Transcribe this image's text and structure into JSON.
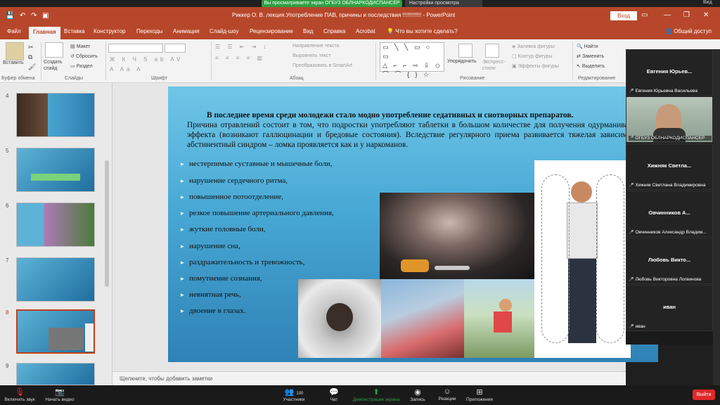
{
  "zoom_top": {
    "banner": "Вы просматриваете экран ОГБУЗ ОБЛНАРКОДИСПАНСЕР",
    "view_options": "Настройки просмотра",
    "view_label": "Вид"
  },
  "ppt": {
    "title": "Риккер О. В. лекция.Употребление ПАВ, причины и последствия  !!!!!!!!!!!!  -  PowerPoint",
    "login": "Вход",
    "tabs": [
      "Файл",
      "Главная",
      "Вставка",
      "Конструктор",
      "Переходы",
      "Анимация",
      "Слайд-шоу",
      "Рецензирование",
      "Вид",
      "Справка",
      "Acrobat",
      "Что вы хотите сделать?"
    ],
    "share": "Общий доступ",
    "ribbon": {
      "paste": "Вставить",
      "clipboard": "Буфер обмена",
      "create_slide": "Создать слайд",
      "layout": "Макет",
      "reset": "Сбросить",
      "section": "Раздел",
      "slides": "Слайды",
      "font": "Шрифт",
      "text_dir": "Направление текста",
      "align_text": "Выровнять текст",
      "smartart": "Преобразовать в SmartArt",
      "paragraph": "Абзац",
      "arrange": "Упорядочить",
      "express": "Экспресс-стили",
      "fill": "Заливка фигуры",
      "outline": "Контур фигуры",
      "effects": "Эффекты фигуры",
      "drawing": "Рисование",
      "find": "Найти",
      "replace": "Заменить",
      "select": "Выделить",
      "editing": "Редактирование"
    },
    "thumb_numbers": [
      "4",
      "5",
      "6",
      "7",
      "8",
      "9"
    ],
    "notes_placeholder": "Щелкните, чтобы добавить заметки"
  },
  "slide": {
    "heading": "В последнее время среди молодежи стало модно употребление седативных и снотворных препаратов.",
    "body": "Причина отравлений состоит в том, что подростки употребляют таблетки в большом количестве для получения одурманивающего эффекта (возникают галлюцинации и бредовые состояния). Вследствие регулярного приема развивается тяжелая зависимость и абстинентный синдром – ломка проявляется как и у наркоманов.",
    "bullets": [
      "нестерпимые суставные и мышечные боли,",
      "нарушение сердечного ритма,",
      "повышенное потоотделение,",
      "резкое повышение артериального давления,",
      "жуткие головные боли,",
      "нарушение сна,",
      "раздражительность и тревожность,",
      "помутнение сознания,",
      "невнятная речь,",
      "двоение в глазах."
    ]
  },
  "participants": [
    {
      "name": "Евгения  Юрьев...",
      "full": "Евгения Юрьевна Васильева"
    },
    {
      "name": "",
      "full": "ОГБУЗ ОБЛНАРКОДИСПАНСЕР",
      "video": true
    },
    {
      "name": "Хижняк  Светла...",
      "full": "Хижняк Светлана Владимировна"
    },
    {
      "name": "Овчинников  А...",
      "full": "Овчинников Александр Владим..."
    },
    {
      "name": "Любовь  Викто...",
      "full": "Любовь Викторовна Логвинова"
    },
    {
      "name": "иван",
      "full": "иван"
    }
  ],
  "zoom_bar": {
    "mute": "Включить звук",
    "video": "Начать видео",
    "participants": "Участники",
    "participants_count": "100",
    "chat": "Чат",
    "share": "Демонстрация экрана",
    "record": "Запись",
    "reactions": "Реакции",
    "apps": "Приложения",
    "end": "Выйти"
  }
}
